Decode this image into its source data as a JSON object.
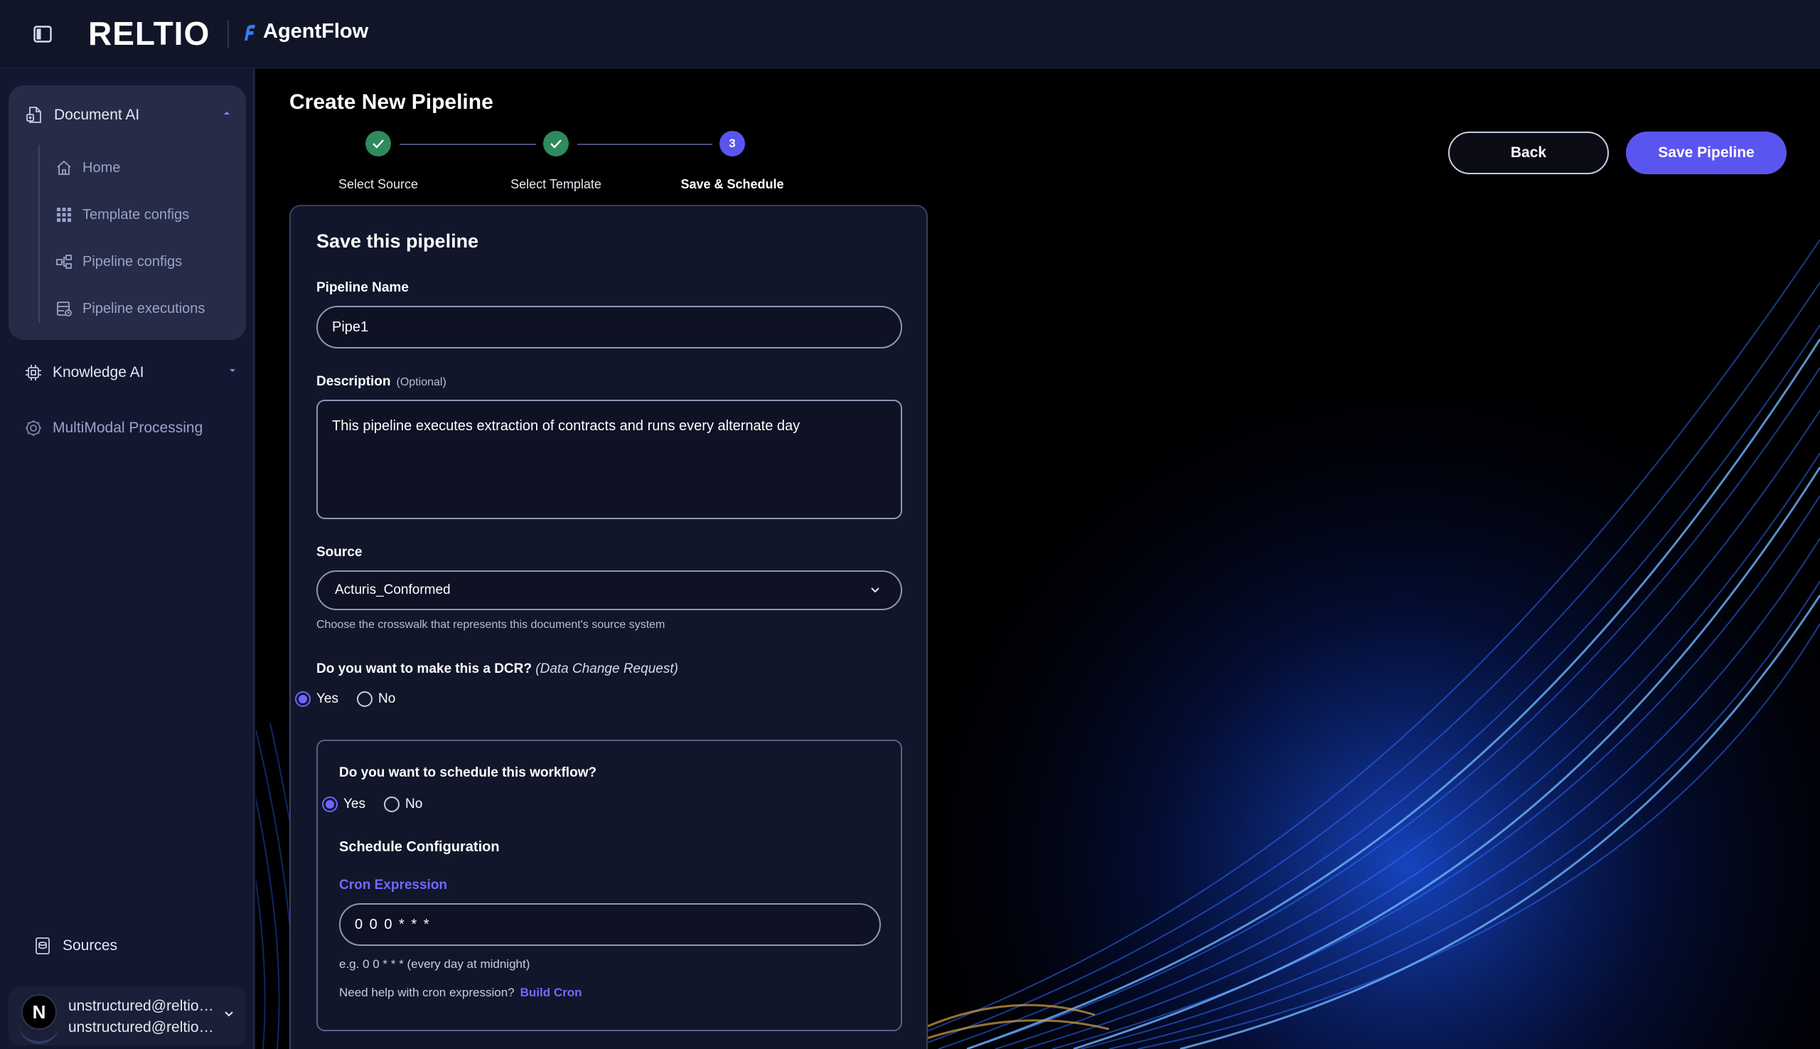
{
  "header": {
    "brand": "RELTIO",
    "product": "AgentFlow"
  },
  "sidebar": {
    "document_ai": {
      "label": "Document AI",
      "items": [
        {
          "label": "Home"
        },
        {
          "label": "Template configs"
        },
        {
          "label": "Pipeline configs"
        },
        {
          "label": "Pipeline executions"
        }
      ]
    },
    "knowledge_ai": {
      "label": "Knowledge AI"
    },
    "multimodal": {
      "label": "MultiModal Processing"
    },
    "sources": {
      "label": "Sources"
    },
    "user": {
      "initial": "N",
      "name": "unstructured@reltio.com",
      "email": "unstructured@reltio.com"
    }
  },
  "page": {
    "title": "Create New Pipeline",
    "steps": [
      {
        "label": "Select Source",
        "state": "done"
      },
      {
        "label": "Select Template",
        "state": "done"
      },
      {
        "label": "Save & Schedule",
        "state": "active",
        "number": "3"
      }
    ],
    "back_label": "Back",
    "save_label": "Save Pipeline"
  },
  "form": {
    "title": "Save this pipeline",
    "pipeline_name": {
      "label": "Pipeline Name",
      "value": "Pipe1"
    },
    "description": {
      "label": "Description",
      "optional": "(Optional)",
      "value": "This pipeline executes extraction of contracts and runs every alternate day"
    },
    "source": {
      "label": "Source",
      "value": "Acturis_Conformed",
      "helper": "Choose the crosswalk that represents this document's source system"
    },
    "dcr": {
      "question": "Do you want to make this a DCR?",
      "question_note": "(Data Change Request)",
      "yes": "Yes",
      "no": "No",
      "selected": "yes"
    },
    "schedule": {
      "question": "Do you want to schedule this workflow?",
      "yes": "Yes",
      "no": "No",
      "selected": "yes",
      "config_title": "Schedule Configuration",
      "cron_label": "Cron Expression",
      "cron_value": "0 0 0 * * *",
      "cron_hint": "e.g. 0 0 * * * (every day at midnight)",
      "help_text": "Need help with cron expression?",
      "help_link": "Build Cron"
    }
  },
  "colors": {
    "accent": "#5b55f0",
    "step_done": "#2f8a5d",
    "link": "#6f6bff",
    "background": "#0b0d1c"
  }
}
